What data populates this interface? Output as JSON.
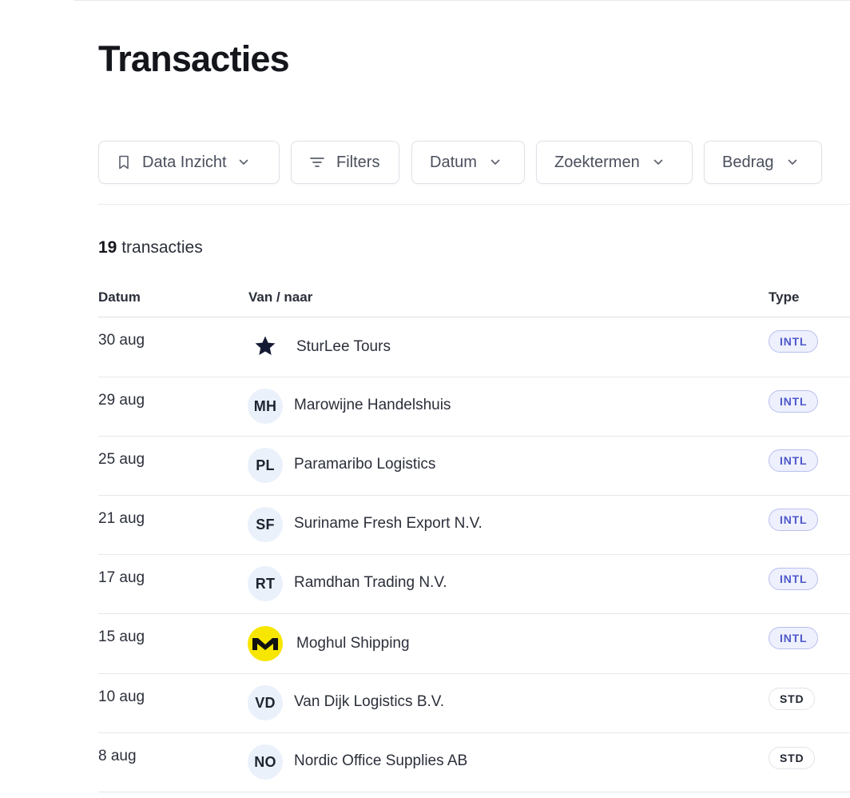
{
  "page": {
    "title": "Transacties"
  },
  "toolbar": {
    "data_inzicht": "Data Inzicht",
    "filters": "Filters",
    "datum": "Datum",
    "zoektermen": "Zoektermen",
    "bedrag": "Bedrag"
  },
  "summary": {
    "count": "19",
    "count_label": " transacties"
  },
  "table": {
    "headers": {
      "datum": "Datum",
      "van_naar": "Van / naar",
      "type": "Type"
    },
    "rows": [
      {
        "date": "30 aug",
        "avatar": "",
        "logo": "star-logo-icon",
        "name": "SturLee Tours",
        "type": "INTL"
      },
      {
        "date": "29 aug",
        "avatar": "MH",
        "logo": "",
        "name": "Marowijne Handelshuis",
        "type": "INTL"
      },
      {
        "date": "25 aug",
        "avatar": "PL",
        "logo": "",
        "name": "Paramaribo Logistics",
        "type": "INTL"
      },
      {
        "date": "21 aug",
        "avatar": "SF",
        "logo": "",
        "name": "Suriname Fresh Export N.V.",
        "type": "INTL"
      },
      {
        "date": "17 aug",
        "avatar": "RT",
        "logo": "",
        "name": "Ramdhan Trading N.V.",
        "type": "INTL"
      },
      {
        "date": "15 aug",
        "avatar": "",
        "logo": "m-logo-icon",
        "name": "Moghul Shipping",
        "type": "INTL"
      },
      {
        "date": "10 aug",
        "avatar": "VD",
        "logo": "",
        "name": "Van Dijk Logistics B.V.",
        "type": "STD"
      },
      {
        "date": "8 aug",
        "avatar": "NO",
        "logo": "",
        "name": "Nordic Office Supplies AB",
        "type": "STD"
      }
    ]
  },
  "colors": {
    "intl_badge_text": "#4e58c9",
    "intl_badge_bg": "#eef0fd",
    "avatar_bg": "#eaf1fb",
    "moghul_logo_bg": "#f7e600"
  }
}
